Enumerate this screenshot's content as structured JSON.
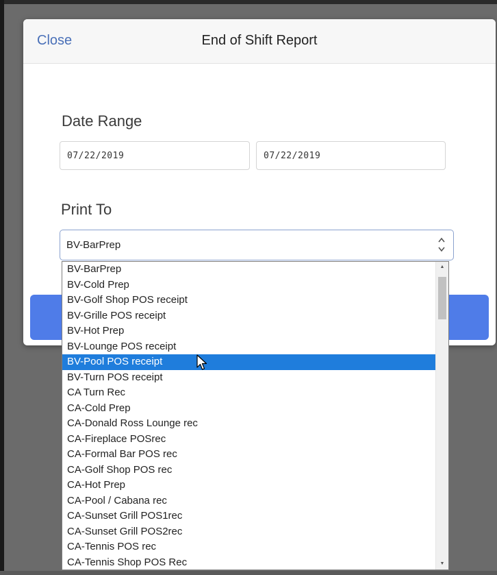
{
  "header": {
    "close_label": "Close",
    "title": "End of Shift Report"
  },
  "date_range": {
    "label": "Date Range",
    "start": "07/22/2019",
    "end": "07/22/2019"
  },
  "print_to": {
    "label": "Print To",
    "selected_value": "BV-BarPrep",
    "options": [
      "BV-BarPrep",
      "BV-Cold Prep",
      "BV-Golf Shop POS receipt",
      "BV-Grille POS receipt",
      "BV-Hot Prep",
      "BV-Lounge POS receipt",
      "BV-Pool POS receipt",
      "BV-Turn POS receipt",
      "CA Turn Rec",
      "CA-Cold Prep",
      "CA-Donald Ross Lounge rec",
      "CA-Fireplace POSrec",
      "CA-Formal Bar POS rec",
      "CA-Golf Shop POS rec",
      "CA-Hot Prep",
      "CA-Pool / Cabana rec",
      "CA-Sunset Grill POS1rec",
      "CA-Sunset Grill POS2rec",
      "CA-Tennis POS rec",
      "CA-Tennis Shop POS Rec"
    ],
    "highlighted_index": 6
  },
  "icons": {
    "select_arrows": "chevron-up-down-icon",
    "scroll_up": "scroll-up-arrow-icon",
    "scroll_down": "scroll-down-arrow-icon",
    "cursor": "mouse-pointer-icon"
  },
  "colors": {
    "accent": "#4f7ce8",
    "link": "#4a70b8",
    "highlight": "#1f7ddc"
  }
}
